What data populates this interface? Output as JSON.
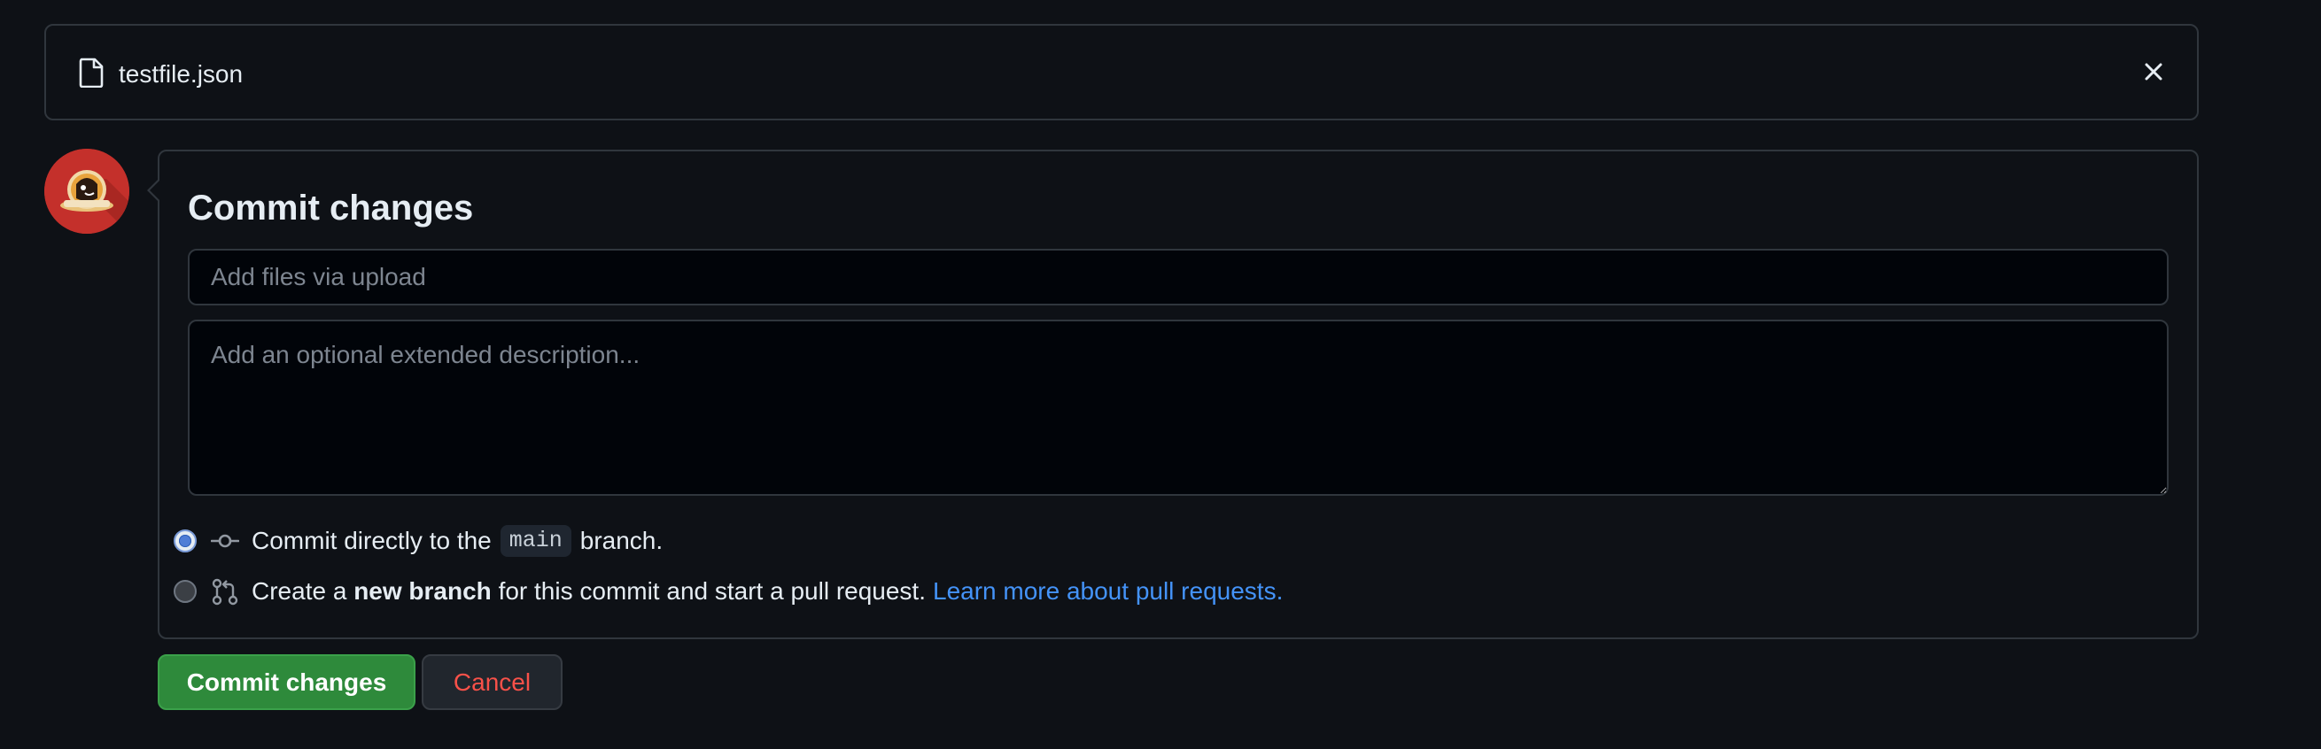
{
  "file_header": {
    "file_name": "testfile.json",
    "file_icon": "file-icon",
    "close_icon": "close-icon"
  },
  "commit_panel": {
    "title": "Commit changes",
    "summary_placeholder": "Add files via upload",
    "description_placeholder": "Add an optional extended description...",
    "option_direct": {
      "prefix": "Commit directly to the",
      "branch": "main",
      "suffix": "branch.",
      "checked": true,
      "icon": "git-commit-icon"
    },
    "option_new_branch": {
      "prefix": "Create a",
      "bold": "new branch",
      "suffix": "for this commit and start a pull request.",
      "link": "Learn more about pull requests.",
      "checked": false,
      "icon": "git-pull-request-icon"
    }
  },
  "buttons": {
    "commit_label": "Commit changes",
    "cancel_label": "Cancel"
  },
  "colors": {
    "background": "#0e1116",
    "border": "#30363d",
    "commit_button": "#2e8a3b",
    "cancel_text": "#f85149",
    "link": "#4493f8"
  }
}
